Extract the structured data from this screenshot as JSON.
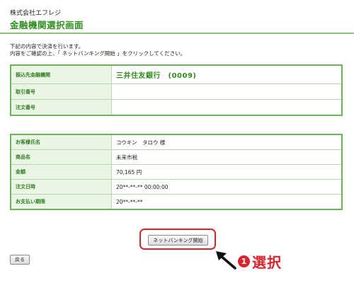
{
  "header": {
    "company": "株式会社エフレジ",
    "title": "金融機関選択画面"
  },
  "intro": {
    "line1": "下記の内容で決済を行います。",
    "line2": "内容をご確認の上、「 ネットバンキング開始 」をクリックしてください。"
  },
  "bank_table": {
    "rows": [
      {
        "label": "振込先金融機関",
        "value": "三井住友銀行　(0009)"
      },
      {
        "label": "取引番号",
        "value": ""
      },
      {
        "label": "注文番号",
        "value": ""
      }
    ]
  },
  "order_table": {
    "rows": [
      {
        "label": "お客様氏名",
        "value": "コウキン　タロウ 様"
      },
      {
        "label": "商品名",
        "value": "未来市税"
      },
      {
        "label": "金額",
        "value": "70,165 円"
      },
      {
        "label": "注文日時",
        "value": "20**-**-** 00:00:00"
      },
      {
        "label": "お支払い期限",
        "value": "20**-**-**"
      }
    ]
  },
  "buttons": {
    "start": "ネットバンキング開始",
    "back": "戻る"
  },
  "annotation": {
    "number": "1",
    "text": "選択"
  },
  "colors": {
    "accent_green": "#2f8f1f",
    "highlight_red": "#d8252c"
  }
}
